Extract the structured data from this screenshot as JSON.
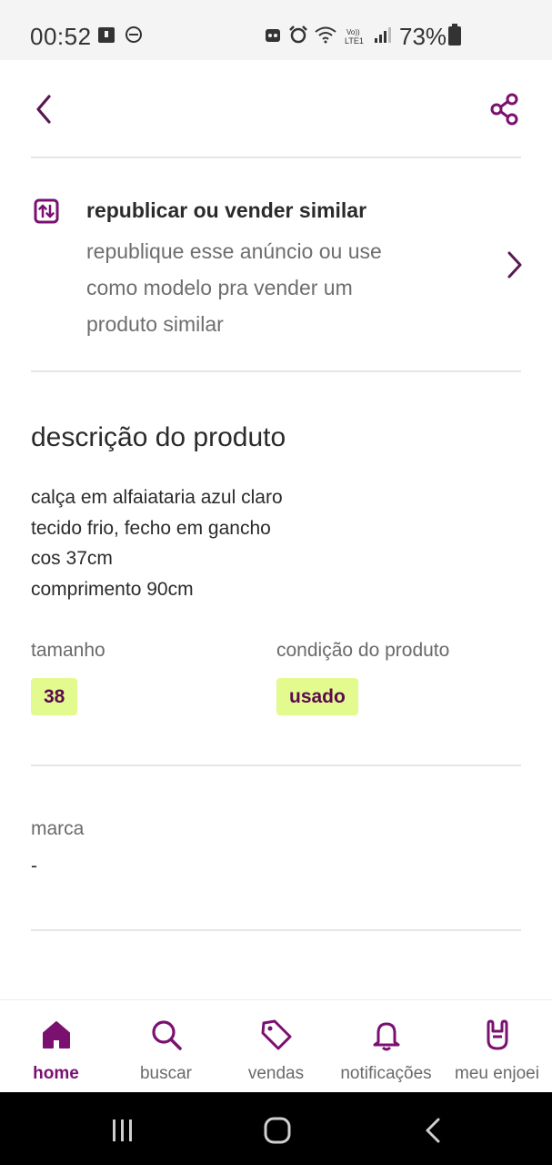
{
  "status_bar": {
    "time": "00:52",
    "battery": "73%",
    "network": "Vo)) LTE1"
  },
  "colors": {
    "brand": "#7a1170",
    "chip_bg": "#e2fa8e",
    "chip_text": "#5c0a4e"
  },
  "top_bar": {
    "back_icon": "chevron-left-icon",
    "share_icon": "share-icon"
  },
  "republish": {
    "icon": "swap-vertical-icon",
    "title": "republicar ou vender similar",
    "lines": [
      "republique esse anúncio ou use",
      "como modelo pra vender um",
      "produto similar"
    ]
  },
  "description": {
    "title": "descrição do produto",
    "lines": [
      "calça em alfaiataria azul claro",
      "tecido frio, fecho em gancho",
      "cos 37cm",
      "comprimento 90cm"
    ]
  },
  "attributes": {
    "size_label": "tamanho",
    "size_value": "38",
    "condition_label": "condição do produto",
    "condition_value": "usado"
  },
  "brand": {
    "label": "marca",
    "value": "-"
  },
  "bottom_nav": {
    "items": [
      {
        "label": "home",
        "icon": "home-icon",
        "active": true
      },
      {
        "label": "buscar",
        "icon": "search-icon",
        "active": false
      },
      {
        "label": "vendas",
        "icon": "tag-icon",
        "active": false
      },
      {
        "label": "notificações",
        "icon": "bell-icon",
        "active": false
      },
      {
        "label": "meu enjoei",
        "icon": "rock-hand-icon",
        "active": false
      }
    ]
  }
}
